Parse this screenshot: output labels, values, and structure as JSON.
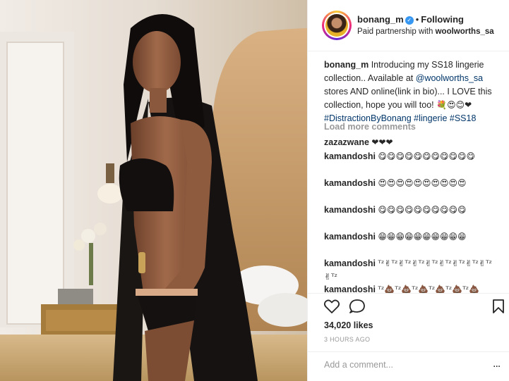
{
  "header": {
    "username": "bonang_m",
    "follow_label": "Following",
    "partnership_prefix": "Paid partnership with ",
    "partnership_brand": "woolworths_sa"
  },
  "caption": {
    "user": "bonang_m",
    "text1": "Introducing my SS18 lingerie collection.. Available at",
    "mention": "@woolworths_sa",
    "text2": "stores AND online(link in bio)... I LOVE this collection, hope you will too!",
    "emojis": "💐😍😊❤",
    "tags": "#DistractionByBonang #lingerie #SS18"
  },
  "load_more": "Load more comments",
  "comments": [
    {
      "user": "zazazwane",
      "text": "❤❤❤"
    },
    {
      "user": "kamandoshi",
      "text": "😋😋😋😋😋😋😋😋😋😋😋"
    },
    {
      "user": "kamandoshi",
      "text": "😍😍😍😍😍😍😍😍😍😍"
    },
    {
      "user": "kamandoshi",
      "text": "😋😋😋😋😋😋😋😋😋😋"
    },
    {
      "user": "kamandoshi",
      "text": "😁😁😁😁😁😁😁😁😁😁"
    },
    {
      "user": "kamandoshi",
      "text": "ᵀᶻ✌ᵀᶻ✌ᵀᶻ✌ᵀᶻ✌ᵀᶻ✌ᵀᶻ✌ᵀᶻ✌ᵀᶻ✌ᵀᶻ✌ᵀᶻ"
    },
    {
      "user": "kamandoshi",
      "text": "ᵀᶻ💩ᵀᶻ💩ᵀᶻ💩ᵀᶻ💩ᵀᶻ💩ᵀᶻ💩"
    }
  ],
  "likes": "34,020 likes",
  "timestamp": "3 HOURS AGO",
  "add_comment_placeholder": "Add a comment...",
  "more_options": "...",
  "icons": [
    "heart-icon",
    "comment-icon",
    "bookmark-icon",
    "verified-badge-icon",
    "more-options-icon"
  ],
  "colors": {
    "link": "#003569",
    "verified": "#3897f0",
    "muted": "#999999"
  }
}
